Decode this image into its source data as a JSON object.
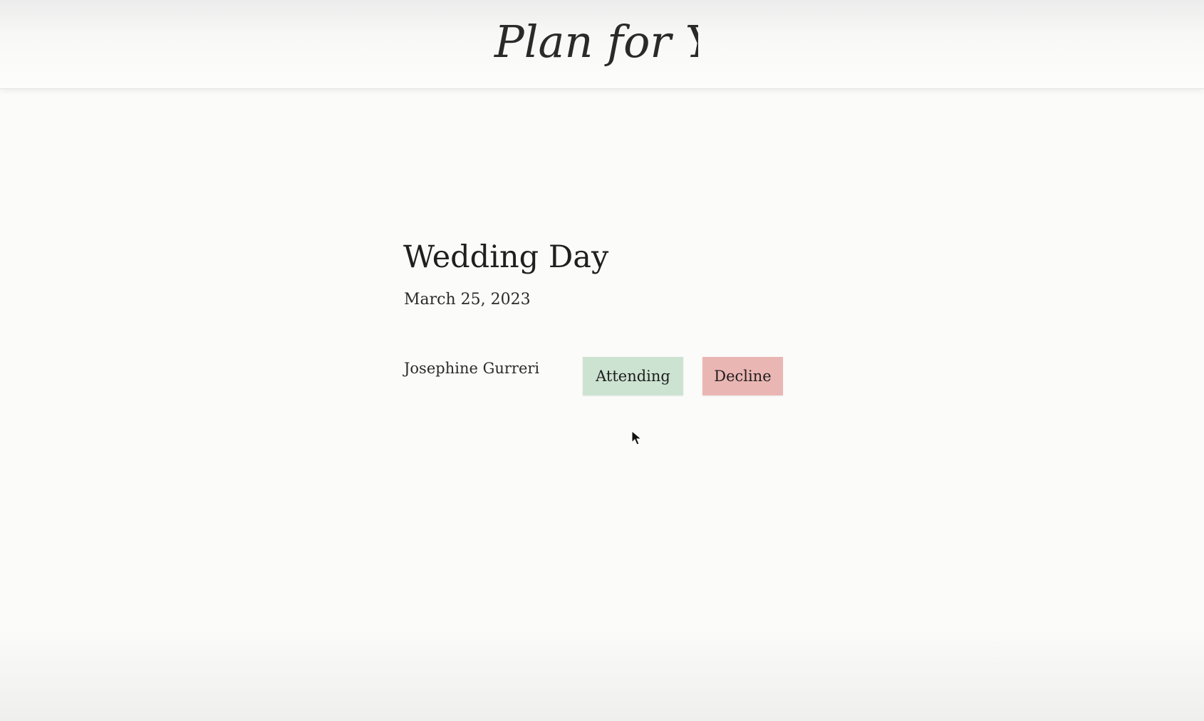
{
  "header": {
    "logo_text": "Plan for You"
  },
  "event": {
    "title": "Wedding Day",
    "date": "March 25, 2023"
  },
  "rsvp": {
    "guest_name": "Josephine Gurreri",
    "attending_label": "Attending",
    "decline_label": "Decline"
  },
  "colors": {
    "background": "#fbfbf9",
    "attending_button": "#cde3d1",
    "decline_button": "#eab6b3",
    "text": "#222222"
  },
  "icons": {
    "cursor": "mouse-pointer-icon"
  }
}
